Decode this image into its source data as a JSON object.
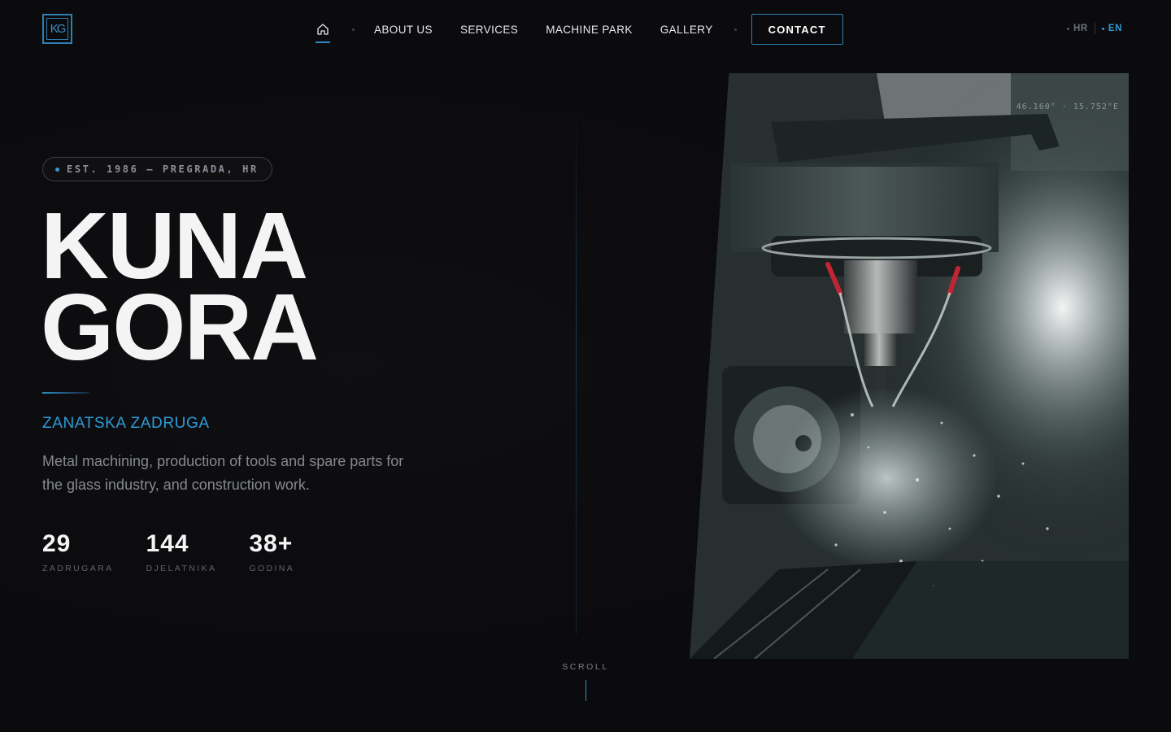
{
  "brand": {
    "logo_text": "KG",
    "accent_color": "#2f9ad6"
  },
  "nav": {
    "home_icon": "home-icon",
    "links": [
      "ABOUT US",
      "SERVICES",
      "MACHINE PARK",
      "GALLERY"
    ],
    "contact_label": "CONTACT"
  },
  "lang": {
    "hr": "HR",
    "en": "EN",
    "active": "EN"
  },
  "hero": {
    "badge": "EST. 1986 — PREGRADA, HR",
    "title_line1": "KUNA",
    "title_line2": "GORA",
    "subtitle": "ZANATSKA ZADRUGA",
    "description": "Metal machining, production of tools and spare parts for the glass industry, and construction work.",
    "stats": [
      {
        "value": "29",
        "label": "ZADRUGARA"
      },
      {
        "value": "144",
        "label": "DJELATNIKA"
      },
      {
        "value": "38+",
        "label": "GODINA"
      }
    ],
    "scroll_label": "SCROLL",
    "image_coords": "46.160° · 15.752°E"
  }
}
